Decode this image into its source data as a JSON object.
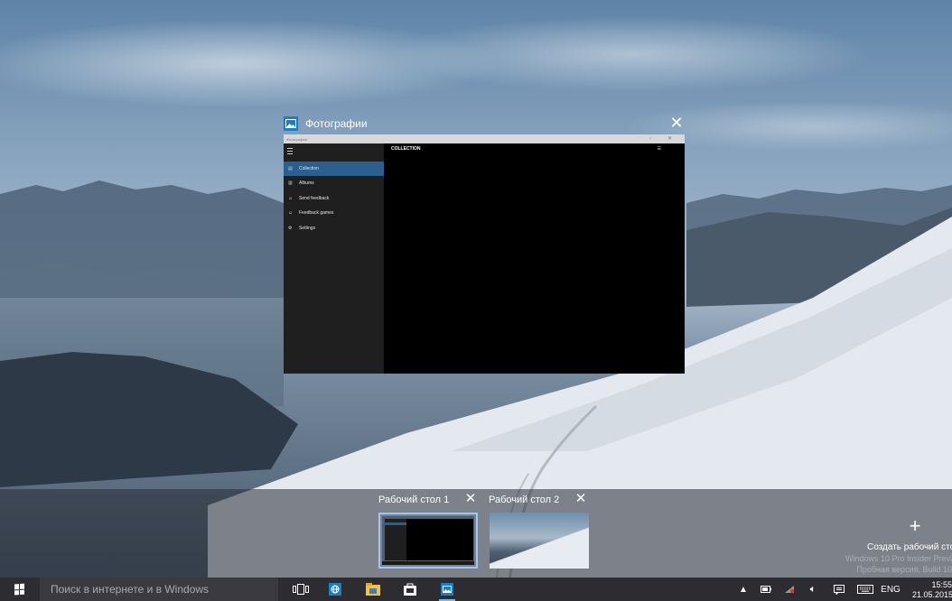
{
  "task_view": {
    "window": {
      "title": "Фотографии",
      "titlebar_text": "Фотографии",
      "main_title": "COLLECTION",
      "sidebar": [
        {
          "label": "Collection",
          "active": true
        },
        {
          "label": "Albums",
          "active": false
        },
        {
          "label": "Send feedback",
          "active": false
        },
        {
          "label": "Feedback games",
          "active": false
        },
        {
          "label": "Settings",
          "active": false
        }
      ]
    },
    "desktops": [
      {
        "label": "Рабочий стол 1",
        "selected": true
      },
      {
        "label": "Рабочий стол 2",
        "selected": false
      }
    ],
    "new_desktop_label": "Создать рабочий сто",
    "watermark_lines": [
      "Windows 10 Pro Insider Previ",
      "Пробная версия. Build 10"
    ]
  },
  "taskbar": {
    "search_placeholder": "Поиск в интернете и в Windows",
    "language": "ENG",
    "time": "15:55",
    "date": "21.05.2015",
    "accent_color": "#76b9ed"
  }
}
